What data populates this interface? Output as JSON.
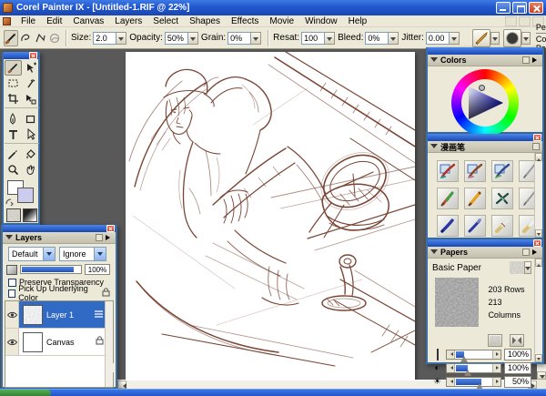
{
  "window": {
    "title": "Corel Painter IX - [Untitled-1.RIF @ 22%]"
  },
  "menu": {
    "items": [
      "File",
      "Edit",
      "Canvas",
      "Layers",
      "Select",
      "Shapes",
      "Effects",
      "Movie",
      "Window",
      "Help"
    ]
  },
  "property_bar": {
    "fields": [
      {
        "label": "Size:",
        "value": "2.0"
      },
      {
        "label": "Opacity:",
        "value": "50%"
      },
      {
        "label": "Grain:",
        "value": "0%"
      },
      {
        "label": "Resat:",
        "value": "100"
      },
      {
        "label": "Bleed:",
        "value": "0%"
      },
      {
        "label": "Jitter:",
        "value": "0.00"
      }
    ],
    "brush_selector": {
      "category": "Pencils",
      "variant": "Cover Pencil"
    }
  },
  "panels": {
    "colors": {
      "title": "Colors"
    },
    "manga": {
      "title": "漫画笔"
    },
    "papers": {
      "title": "Papers",
      "paper_name": "Basic Paper",
      "rows": "203 Rows",
      "columns": "213 Columns",
      "sliders": [
        {
          "name": "paper-scale",
          "value": "100%"
        },
        {
          "name": "paper-contrast",
          "value": "100%"
        },
        {
          "name": "paper-brightness",
          "value": "50%"
        }
      ],
      "icons": {
        "contrast": "◐",
        "brightness": "☀"
      }
    },
    "layers": {
      "title": "Layers",
      "composite_method": "Default",
      "composite_depth": "Ignore",
      "opacity": "100%",
      "checkbox1": "Preserve Transparency",
      "checkbox2": "Pick Up Underlying Color",
      "items": [
        {
          "name": "Layer 1"
        },
        {
          "name": "Canvas"
        }
      ]
    }
  },
  "accents": {
    "titlebar_blue": "#2258d0",
    "selection_blue": "#316ac5",
    "doc_background": "#595959",
    "sketch_ink": "#7a4535"
  }
}
